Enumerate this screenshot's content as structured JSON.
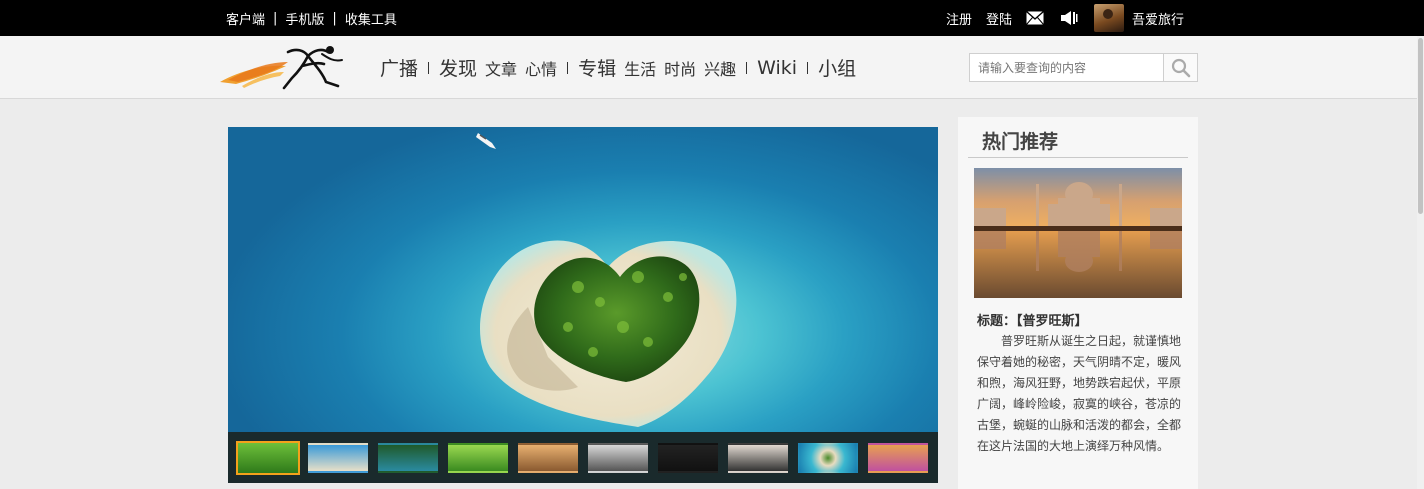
{
  "topbar": {
    "links_left": [
      "客户端",
      "手机版",
      "收集工具"
    ],
    "separator": "|",
    "register": "注册",
    "login": "登陆",
    "username": "吾爱旅行"
  },
  "nav": {
    "items": [
      {
        "label": "广播",
        "size": "big",
        "bar": true
      },
      {
        "label": "发现",
        "size": "big",
        "bar": false
      },
      {
        "label": "文章",
        "size": "small",
        "bar": false
      },
      {
        "label": "心情",
        "size": "small",
        "bar": true
      },
      {
        "label": "专辑",
        "size": "big",
        "bar": false
      },
      {
        "label": "生活",
        "size": "small",
        "bar": false
      },
      {
        "label": "时尚",
        "size": "small",
        "bar": false
      },
      {
        "label": "兴趣",
        "size": "small",
        "bar": true
      },
      {
        "label": "Wiki",
        "size": "big",
        "bar": true
      },
      {
        "label": "小组",
        "size": "big",
        "bar": false
      }
    ]
  },
  "search": {
    "placeholder": "请输入要查询的内容"
  },
  "icons": {
    "mail": "mail-icon",
    "speaker": "speaker-icon",
    "search": "search-icon"
  },
  "colors": {
    "topbar_bg": "#000000",
    "active_thumb_border": "#f4a11b",
    "ocean": "#1a7fb0"
  },
  "sidebar": {
    "heading": "热门推荐",
    "feature_title": "标题：【普罗旺斯】",
    "feature_body": "普罗旺斯从诞生之日起，就谨慎地保守着她的秘密，天气阴晴不定，暖风和煦，海风狂野，地势跌宕起伏，平原广阔，峰岭险峻，寂寞的峡谷，苍凉的古堡，蜿蜒的山脉和活泼的都会，全都在这片法国的大地上演绎万种风情。"
  },
  "thumbnails": {
    "active_index": 0,
    "count": 10
  }
}
